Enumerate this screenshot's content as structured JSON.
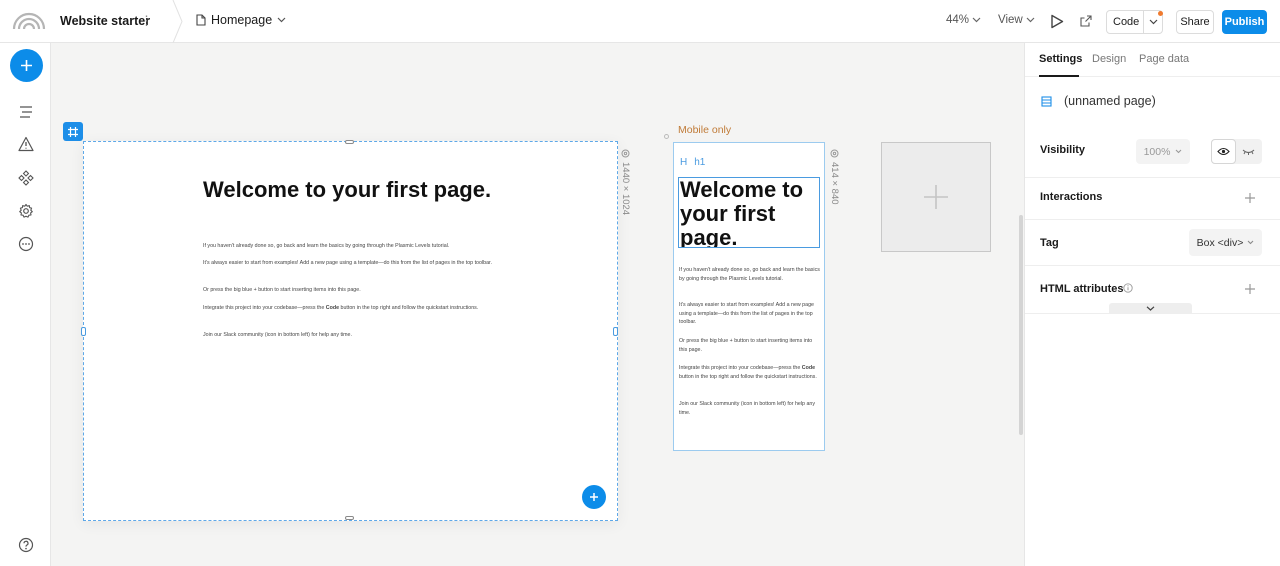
{
  "topbar": {
    "project_name": "Website starter",
    "project_menu": "⋮",
    "page_name": "Homepage",
    "zoom": "44%",
    "view_label": "View",
    "code_label": "Code",
    "share_label": "Share",
    "publish_label": "Publish",
    "icons": [
      "logo-icon",
      "page-icon",
      "chevron-down-icon",
      "play-icon",
      "external-link-icon"
    ],
    "colors": {
      "accent": "#0c8ce9",
      "notification": "#f07a2e"
    }
  },
  "leftrail": {
    "icons": [
      "plus-icon",
      "outline-icon",
      "warning-icon",
      "components-icon",
      "settings-icon",
      "more-icon",
      "help-icon"
    ]
  },
  "canvas": {
    "desktop_frame": {
      "dimensions": "1440 × 1024",
      "title": "Welcome to your first page.",
      "paragraphs": [
        "If you haven't already done so, go back and learn the basics by going through the Plasmic Levels tutorial.",
        "It's always easier to start from examples! Add a new page using a template—do this from the list of pages in the top toolbar.",
        "Or press the big blue + button to start inserting items into this page.",
        "Join our Slack community (icon in bottom left) for help any time."
      ],
      "codebase_para": {
        "before": "Integrate this project into your codebase—press the ",
        "bold": "Code",
        "after": " button in the top right and follow the quickstart instructions."
      }
    },
    "mobile_frame": {
      "label": "Mobile only",
      "dimensions": "414 × 840",
      "tag_letter": "H",
      "tag_name": "h1",
      "title": "Welcome to your first page.",
      "paragraphs": [
        "If you haven't already done so, go back and learn the basics by going through the Plasmic Levels tutorial.",
        "It's always easier to start from examples! Add a new page using a template—do this from the list of pages in the top toolbar.",
        "Or press the big blue + button to start inserting items into this page.",
        "Join our Slack community (icon in bottom left) for help any time."
      ],
      "codebase_para": {
        "before": "Integrate this project into your codebase—press the ",
        "bold": "Code",
        "after": " button in the top right and follow the quickstart instructions."
      }
    }
  },
  "panel": {
    "tabs": [
      {
        "label": "Settings",
        "active": true
      },
      {
        "label": "Design",
        "active": false
      },
      {
        "label": "Page data",
        "active": false
      }
    ],
    "page_name": "(unnamed page)",
    "visibility": {
      "label": "Visibility",
      "value": "100%"
    },
    "interactions_label": "Interactions",
    "tag": {
      "label": "Tag",
      "value": "Box <div>"
    },
    "html_attributes_label": "HTML attributes"
  }
}
